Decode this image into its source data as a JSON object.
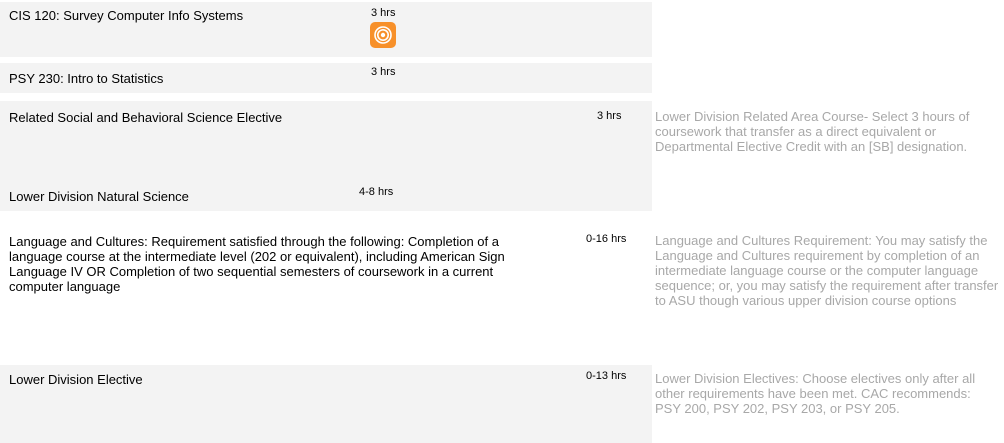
{
  "courses": [
    {
      "name": "CIS 120: Survey Computer Info Systems",
      "hours": "3 hrs",
      "note": "",
      "icon": "rss-icon"
    },
    {
      "name": "PSY 230: Intro to Statistics",
      "hours": "3 hrs",
      "note": ""
    },
    {
      "name": "Related Social and Behavioral Science Elective",
      "hours": "3 hrs",
      "note": "Lower Division Related Area Course- Select 3 hours of coursework that transfer as a direct equivalent or Departmental Elective Credit with an [SB] designation."
    },
    {
      "name": "Lower Division Natural Science",
      "hours": "4-8 hrs",
      "note": ""
    },
    {
      "name": "Language and Cultures: Requirement satisfied through the following: Completion of a language course at the intermediate level (202 or equivalent), including American Sign Language IV OR Completion of two sequential semesters of coursework in a current computer language",
      "hours": "0-16 hrs",
      "note": "Language and Cultures Requirement: You may satisfy the Language and Cultures requirement by completion of an intermediate language course or the computer language sequence; or, you may satisfy the requirement after transfer to ASU though various upper division course options"
    },
    {
      "name": "Lower Division Elective",
      "hours": "0-13 hrs",
      "note": "Lower Division Electives: Choose electives only after all other requirements have been met. CAC recommends: PSY 200, PSY 202, PSY 203, or PSY 205."
    }
  ],
  "colors": {
    "row_background": "#f3f3f3",
    "note_text": "#a8a8a8",
    "rss_icon": "#f7902a"
  }
}
